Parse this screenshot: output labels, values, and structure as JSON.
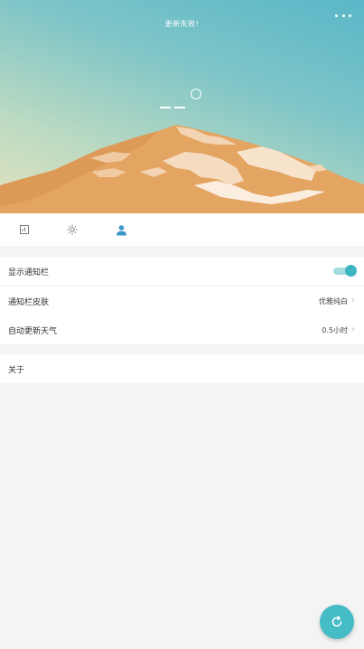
{
  "header": {
    "status_text": "更新失败!",
    "temperature_placeholder": "- -",
    "more_icon": "more-dots-icon"
  },
  "tabs": [
    {
      "name": "weather",
      "icon": "weather-chart-icon",
      "active": false
    },
    {
      "name": "sun",
      "icon": "sun-icon",
      "active": false
    },
    {
      "name": "me",
      "icon": "person-icon",
      "active": true
    }
  ],
  "settings": {
    "show_notification": {
      "label": "显示通知栏",
      "enabled": true
    },
    "notification_skin": {
      "label": "通知栏皮肤",
      "value": "优雅纯白"
    },
    "auto_update": {
      "label": "自动更新天气",
      "value": "0.5小时"
    },
    "about": {
      "label": "关于"
    }
  },
  "fab": {
    "icon": "refresh-icon"
  },
  "colors": {
    "accent": "#45bcc6",
    "sky_top": "#5ab7c8",
    "sky_bottom": "#e6e4bd",
    "mountain": "#e4a462",
    "snow": "#fbeee0",
    "background": "#f4f4f4"
  }
}
